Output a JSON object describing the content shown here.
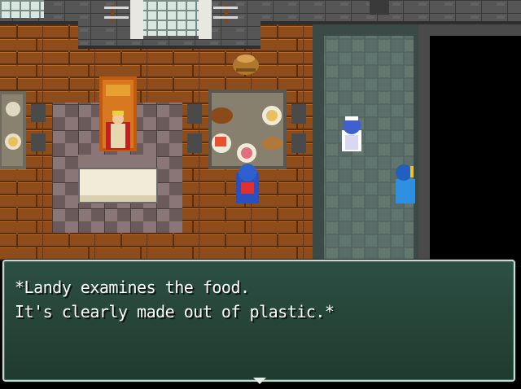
{
  "dialog": {
    "lines": [
      "*Landy examines the food.",
      "It's clearly made out of plastic.*"
    ]
  },
  "colors": {
    "wood_floor": "#8a4a1a",
    "stone_floor": "#5c6e6a",
    "wall": "#4a4a4a",
    "dialog_bg": "#264438",
    "dialog_border": "#c8d8d0",
    "text": "#ffffff"
  },
  "icons": {
    "advance": "advance-cursor-icon"
  }
}
